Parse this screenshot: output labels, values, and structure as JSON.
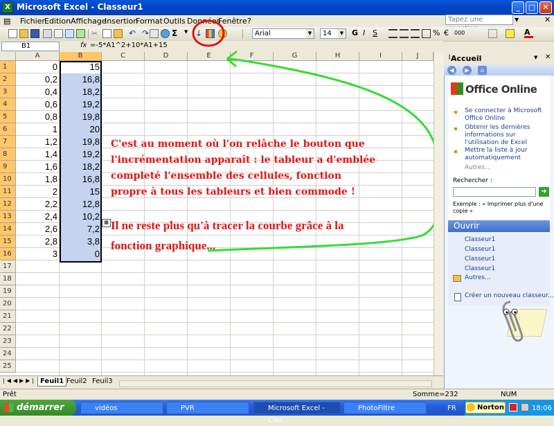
{
  "window": {
    "title": "Microsoft Excel - Classeur1"
  },
  "menu": {
    "items": [
      "Fichier",
      "Edition",
      "Affichage",
      "Insertion",
      "Format",
      "Outils",
      "Données",
      "Fenêtre",
      "?"
    ],
    "ask_placeholder": "Tapez une question"
  },
  "toolbar": {
    "font": "Arial",
    "size": "14",
    "currency": "€",
    "percent": "%",
    "thousands": "000",
    "sigma": "Σ"
  },
  "formula_bar": {
    "name_box": "B1",
    "fx": "fx",
    "formula": "=-5*A1^2+10*A1+15"
  },
  "sheet": {
    "columns": [
      "A",
      "B",
      "C",
      "D",
      "E",
      "F",
      "G",
      "H",
      "I",
      "J"
    ],
    "rows": [
      "1",
      "2",
      "3",
      "4",
      "5",
      "6",
      "7",
      "8",
      "9",
      "10",
      "11",
      "12",
      "13",
      "14",
      "15",
      "16",
      "17",
      "18",
      "19",
      "20",
      "21",
      "22",
      "23",
      "24",
      "25"
    ],
    "col_a": [
      "0",
      "0,2",
      "0,4",
      "0,6",
      "0,8",
      "1",
      "1,2",
      "1,4",
      "1,6",
      "1,8",
      "2",
      "2,2",
      "2,4",
      "2,6",
      "2,8",
      "3"
    ],
    "col_b": [
      "15",
      "16,8",
      "18,2",
      "19,2",
      "19,8",
      "20",
      "19,8",
      "19,2",
      "18,2",
      "16,8",
      "15",
      "12,8",
      "10,2",
      "7,2",
      "3,8",
      "0"
    ],
    "tabs": [
      "Feuil1",
      "Feuil2",
      "Feuil3"
    ]
  },
  "annotation": {
    "text1": [
      "C'est au moment où l'on relâche le bouton que",
      "l'incrémentation apparaît : le tableur a d'emblée",
      "completé l'ensemble des cellules, fonction",
      "propre à tous les tableurs et bien commode !"
    ],
    "text2": [
      "Il ne reste plus qu'à tracer la courbe grâce à la",
      "fonction graphique..."
    ]
  },
  "status": {
    "left": "Prêt",
    "sum": "Somme=232",
    "num": "NUM"
  },
  "task_pane": {
    "title": "Accueil",
    "brand": "Office Online",
    "links": [
      "Se connecter à Microsoft Office Online",
      "Obtenir les dernières informations sur l'utilisation de Excel",
      "Mettre la liste à jour automatiquement"
    ],
    "more1": "Autres...",
    "search_label": "Rechercher :",
    "example": "Exemple :  « Imprimer plus d'une copie »",
    "open_header": "Ouvrir",
    "files": [
      "Classeur1",
      "Classeur1",
      "Classeur1",
      "Classeur1"
    ],
    "more2": "Autres...",
    "new_workbook": "Créer un nouveau classeur..."
  },
  "taskbar": {
    "start": "démarrer",
    "tasks": [
      "vidéos",
      "PVR",
      "Microsoft Excel - Clas...",
      "PhotoFiltre"
    ],
    "lang": "FR",
    "norton": "Norton",
    "clock": "18:06"
  },
  "colors": {
    "annotation_red": "#e01414",
    "arrow_green": "#33dd33",
    "circle_red": "#e01414",
    "selection": "#c4d4ee"
  }
}
